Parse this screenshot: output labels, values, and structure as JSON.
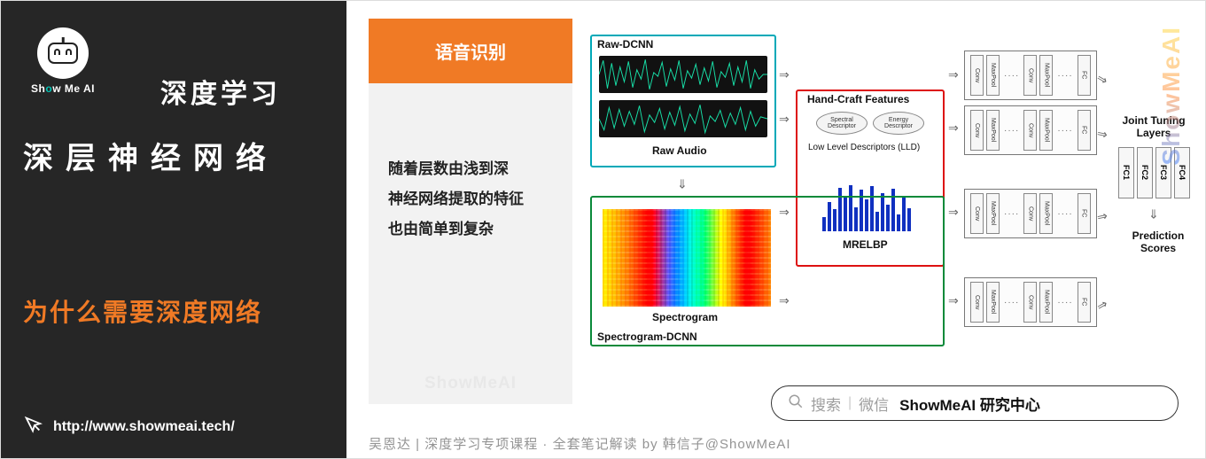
{
  "sidebar": {
    "logo_text_pre": "Sh",
    "logo_text_o": "o",
    "logo_text_post": "w Me AI",
    "title1": "深度学习",
    "title2": "深层神经网络",
    "title3": "为什么需要深度网络",
    "link": "http://www.showmeai.tech/"
  },
  "card": {
    "header": "语音识别",
    "line1": "随着层数由浅到深",
    "line2": "神经网络提取的特征",
    "line3": "也由简单到复杂",
    "watermark": "ShowMeAI"
  },
  "diagram": {
    "raw_dcnn": "Raw-DCNN",
    "raw_audio": "Raw Audio",
    "hand_craft": "Hand-Craft Features",
    "desc1": "Spectral Descriptor",
    "desc2": "Energy Descriptor",
    "lld": "Low Level Descriptors (LLD)",
    "mrelbp": "MRELBP",
    "spectrogram": "Spectrogram",
    "spec_dcnn": "Spectrogram-DCNN",
    "joint_tuning": "Joint Tuning Layers",
    "prediction": "Prediction Scores",
    "layers": {
      "conv": "Conv",
      "pool": "MaxPool",
      "fc": "FC"
    },
    "fc1": "FC1",
    "fc2": "FC2",
    "fc3": "FC3",
    "fc4": "FC4"
  },
  "search": {
    "label1": "搜索",
    "label2": "微信",
    "brand": "ShowMeAI 研究中心"
  },
  "caption": "吴恩达 | 深度学习专项课程 · 全套笔记解读  by 韩信子@ShowMeAI",
  "vertical_wm": "ShowMeAI"
}
